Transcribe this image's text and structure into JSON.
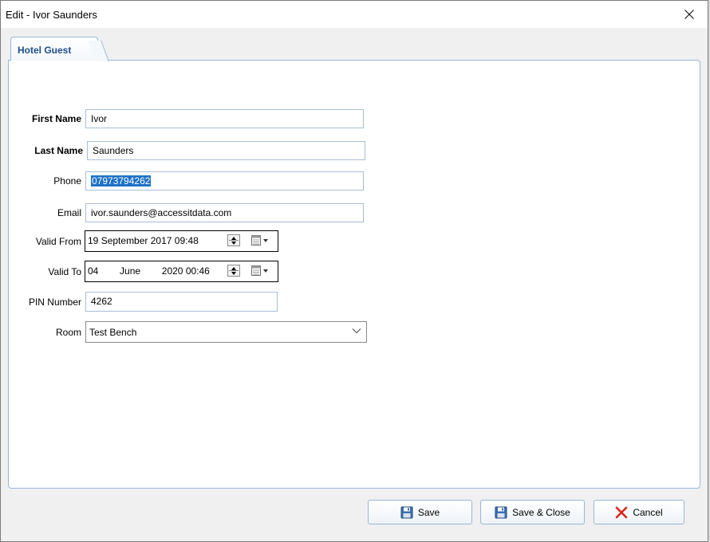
{
  "window": {
    "title": "Edit - Ivor Saunders"
  },
  "tabs": [
    {
      "label": "Hotel Guest",
      "active": true
    }
  ],
  "form": {
    "first_name": {
      "label": "First Name",
      "value": "Ivor"
    },
    "last_name": {
      "label": "Last Name",
      "value": "Saunders"
    },
    "phone": {
      "label": "Phone",
      "value": "07973794262"
    },
    "email": {
      "label": "Email",
      "value": "ivor.saunders@accessitdata.com"
    },
    "valid_from": {
      "label": "Valid From",
      "day": "19",
      "month": "September",
      "year": "2017",
      "time": "09:48"
    },
    "valid_to": {
      "label": "Valid To",
      "day": "04",
      "month": "June",
      "year": "2020",
      "time": "00:46"
    },
    "pin": {
      "label": "PIN Number",
      "value": "4262"
    },
    "room": {
      "label": "Room",
      "value": "Test Bench"
    }
  },
  "buttons": {
    "save": "Save",
    "save_close": "Save & Close",
    "cancel": "Cancel"
  },
  "colors": {
    "accent_border": "#9bb6d6",
    "tab_text": "#1f4e8a",
    "selection": "#1e72c8",
    "cancel_x": "#d9261c"
  }
}
